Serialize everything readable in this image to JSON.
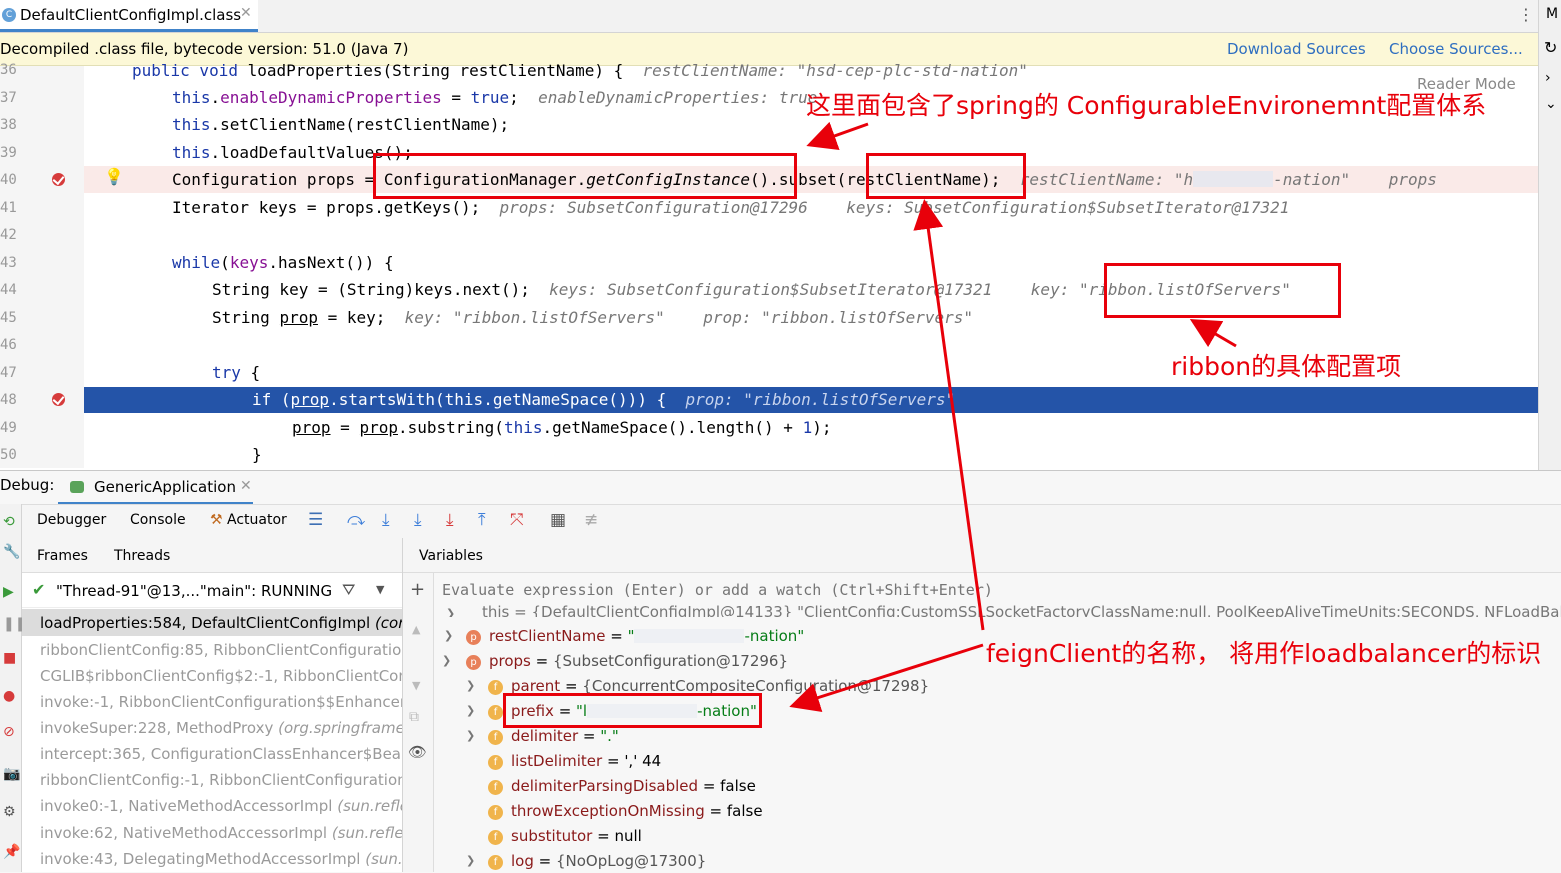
{
  "tab": {
    "title": "DefaultClientConfigImpl.class",
    "icon": "class-file-icon"
  },
  "banner": {
    "text": "Decompiled .class file, bytecode version: 51.0 (Java 7)",
    "download_sources": "Download Sources",
    "choose_sources": "Choose Sources..."
  },
  "editor": {
    "reader_mode": "Reader Mode",
    "lines": [
      {
        "n": "36",
        "code": "public void loadProperties(String restClientName) {",
        "hint": "restClientName: \"hsd-cep-plc-std-nation\""
      },
      {
        "n": "37",
        "code": "this.enableDynamicProperties = true;",
        "hint": "enableDynamicProperties: true"
      },
      {
        "n": "38",
        "code": "this.setClientName(restClientName);",
        "hint": ""
      },
      {
        "n": "39",
        "code": "this.loadDefaultValues();",
        "hint": ""
      },
      {
        "n": "40",
        "code": "Configuration props = ConfigurationManager.getConfigInstance().subset(restClientName);",
        "hint": "restClientName: \"h",
        "hint_end": "-nation\"",
        "hint_props": "props"
      },
      {
        "n": "41",
        "code": "Iterator keys = props.getKeys();",
        "hint": "props: SubsetConfiguration@17296    keys: SubsetConfiguration$SubsetIterator@17321"
      },
      {
        "n": "42",
        "code": "",
        "hint": ""
      },
      {
        "n": "43",
        "code": "while(keys.hasNext()) {",
        "hint": ""
      },
      {
        "n": "44",
        "code": "String key = (String)keys.next();",
        "hint": "keys: SubsetConfiguration$SubsetIterator@17321    key: \"ribbon.listOfServers\""
      },
      {
        "n": "45",
        "code": "String prop = key;",
        "hint": "key: \"ribbon.listOfServers\"    prop: \"ribbon.listOfServers\""
      },
      {
        "n": "46",
        "code": "",
        "hint": ""
      },
      {
        "n": "47",
        "code": "try {",
        "hint": ""
      },
      {
        "n": "48",
        "code": "if (prop.startsWith(this.getNameSpace())) {",
        "hint": "prop: \"ribbon.listOfServers\""
      },
      {
        "n": "49",
        "code": "prop = prop.substring(this.getNameSpace().length() + 1);",
        "hint": ""
      },
      {
        "n": "50",
        "code": "}",
        "hint": ""
      }
    ]
  },
  "annotations": {
    "spring": "这里面包含了spring的 ConfigurableEnvironemnt配置体系",
    "ribbon": "ribbon的具体配置项",
    "feign": "feignClient的名称，  将用作loadbalancer的标识"
  },
  "debug": {
    "label": "Debug:",
    "app_tab": "GenericApplication",
    "toolbar": {
      "debugger": "Debugger",
      "console": "Console",
      "actuator": "Actuator"
    },
    "frames_tab": "Frames",
    "threads_tab": "Threads",
    "variables_tab": "Variables",
    "thread": "\"Thread-91\"@13,...\"main\": RUNNING",
    "frames": [
      {
        "method": "loadProperties:584, DefaultClientConfigImpl",
        "pkg": "(com"
      },
      {
        "method": "ribbonClientConfig:85, RibbonClientConfiguratio",
        "pkg": ""
      },
      {
        "method": "CGLIB$ribbonClientConfig$2:-1, RibbonClientCon",
        "pkg": ""
      },
      {
        "method": "invoke:-1, RibbonClientConfiguration$$EnhancerB",
        "pkg": ""
      },
      {
        "method": "invokeSuper:228, MethodProxy",
        "pkg": "(org.springframe"
      },
      {
        "method": "intercept:365, ConfigurationClassEnhancer$BeanM",
        "pkg": ""
      },
      {
        "method": "ribbonClientConfig:-1, RibbonClientConfiguration",
        "pkg": ""
      },
      {
        "method": "invoke0:-1, NativeMethodAccessorImpl",
        "pkg": "(sun.refle"
      },
      {
        "method": "invoke:62, NativeMethodAccessorImpl",
        "pkg": "(sun.reflec"
      },
      {
        "method": "invoke:43, DelegatingMethodAccessorImpl",
        "pkg": "(sun.r"
      }
    ],
    "eval_placeholder": "Evaluate expression (Enter) or add a watch (Ctrl+Shift+Enter)",
    "variables": {
      "this_row": "this = {DefaultClientConfigImpl@14133} \"ClientConfig:CustomSSLSocketFactoryClassName:null, PoolKeepAliveTimeUnits:SECONDS, NFLoadBalancer",
      "restClientName_key": "restClientName",
      "restClientName_val_end": "-nation\"",
      "props_key": "props",
      "props_val": "{SubsetConfiguration@17296}",
      "parent_key": "parent",
      "parent_val": "{ConcurrentCompositeConfiguration@17298}",
      "prefix_key": "prefix",
      "prefix_val_start": "\"l",
      "prefix_val_end": "-nation\"",
      "delimiter_key": "delimiter",
      "delimiter_val": "\".\"",
      "listDelimiter_key": "listDelimiter",
      "listDelimiter_val": "',' 44",
      "delimiterParsingDisabled_key": "delimiterParsingDisabled",
      "delimiterParsingDisabled_val": "false",
      "throwExceptionOnMissing_key": "throwExceptionOnMissing",
      "throwExceptionOnMissing_val": "false",
      "substitutor_key": "substitutor",
      "substitutor_val": "null",
      "log_key": "log",
      "log_val": "{NoOpLog@17300}"
    }
  },
  "colors": {
    "accent": "#2454a8",
    "annotation": "#e8000a",
    "breakpoint": "#d63b3b"
  }
}
